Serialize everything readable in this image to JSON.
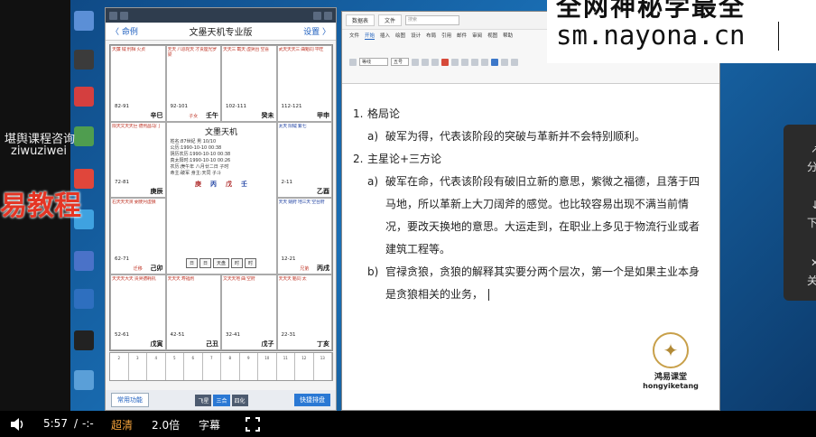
{
  "overlay": {
    "consult_line1": "堪舆课程咨询",
    "consult_line2": "ziwuziwei",
    "brand": "易教程"
  },
  "watermark": {
    "line1": "全网神秘学最全",
    "line2": "sm.nayona.cn"
  },
  "phone": {
    "nav_back": "〈 命例",
    "nav_title": "文墨天机专业版",
    "nav_save": "设置 〉",
    "center_title": "文墨天机",
    "center_lines": [
      "姓名:87世紀 男 10/10",
      "公历:1990-10-10 00:38",
      "阴历农历:1990-10-10 00:38",
      "真太阳时:1990-10-10 00:26",
      "农历:庚午年 八月廿二日 子时",
      "命主:破军 身主:天同 子斗"
    ],
    "pillars": [
      "庚",
      "丙",
      "戊",
      "壬"
    ],
    "center_buttons": [
      "日",
      "日",
      "天盘",
      "时",
      "时"
    ],
    "bottom_left": "常用功能",
    "bottom_mid": [
      "飞星",
      "三合",
      "四化"
    ],
    "bottom_right": "快捷排盘",
    "palaces": [
      {
        "stars": "天廉 钺 刑相 火贞",
        "minor": "",
        "age": "82-91",
        "gz": "辛巳",
        "name": "",
        "blue": false
      },
      {
        "stars": "天天 八恩陀天 才贵座光罗梁",
        "minor": "",
        "age": "92-101",
        "gz": "壬午",
        "name": "子女",
        "blue": false
      },
      {
        "stars": "天天三 截天 虚哭台 空喜",
        "minor": "",
        "age": "102-111",
        "gz": "癸未",
        "name": "",
        "blue": false
      },
      {
        "stars": "武天天天三 曲魁同 平旺",
        "minor": "",
        "age": "112-121",
        "gz": "甲申",
        "name": "",
        "blue": false
      },
      {
        "stars": "陨天文天天巨 德刑昌马门",
        "minor": "",
        "age": "72-81",
        "gz": "庚辰",
        "name": "",
        "blue": false
      },
      {
        "stars": "",
        "minor": "",
        "age": "",
        "gz": "",
        "name": "",
        "blue": false
      },
      {
        "stars": "",
        "minor": "",
        "age": "",
        "gz": "",
        "name": "",
        "blue": false
      },
      {
        "stars": "太天 阳钺 紫七",
        "minor": "",
        "age": "2-11",
        "gz": "乙酉",
        "name": "",
        "blue": true
      },
      {
        "stars": "右天天天贪 弼使月虚狼",
        "minor": "",
        "age": "62-71",
        "gz": "己卯",
        "name": "迁移",
        "blue": false
      },
      {
        "stars": "",
        "minor": "",
        "age": "",
        "gz": "",
        "name": "",
        "blue": false
      },
      {
        "stars": "",
        "minor": "",
        "age": "",
        "gz": "",
        "name": "",
        "blue": false
      },
      {
        "stars": "天天 姚府 地三天 空台府",
        "minor": "",
        "age": "12-21",
        "gz": "丙戌",
        "name": "兄弟",
        "blue": true
      },
      {
        "stars": "天天天大天 贵哭德耗机",
        "minor": "",
        "age": "52-61",
        "gz": "戊寅",
        "name": "",
        "blue": false
      },
      {
        "stars": "天天天 寿福刑",
        "minor": "",
        "age": "42-51",
        "gz": "己丑",
        "name": "",
        "blue": false
      },
      {
        "stars": "文天天地 曲 空府",
        "minor": "",
        "age": "32-41",
        "gz": "戊子",
        "name": "",
        "blue": false
      },
      {
        "stars": "天天天 魁同 太",
        "minor": "",
        "age": "22-31",
        "gz": "丁亥",
        "name": "",
        "blue": false
      }
    ],
    "age_row": [
      "2",
      "3",
      "4",
      "5",
      "6",
      "7",
      "8",
      "9",
      "10",
      "11",
      "12",
      "13"
    ]
  },
  "word": {
    "tab1": "数据表",
    "tab2": "文件",
    "search_placeholder": "搜索",
    "menu": [
      "文件",
      "开始",
      "插入",
      "绘图",
      "设计",
      "布局",
      "引用",
      "邮件",
      "审阅",
      "视图",
      "帮助"
    ],
    "active_menu": "开始",
    "font_box": "等线",
    "size_box": "五号",
    "doc": [
      {
        "num": "1.",
        "text": "格局论"
      },
      {
        "num": "a)",
        "text": "破军为得，代表该阶段的突破与革新并不会特别顺利。",
        "lvl": 2
      },
      {
        "num": "2.",
        "text": "主星论+三方论"
      },
      {
        "num": "a)",
        "text": "破军在命，代表该阶段有破旧立新的意思，紫微之福德，且落于四马地，所以革新上大刀阔斧的感觉。也比较容易出现不满当前情况，要改天换地的意思。大运走到，在职业上多见于物流行业或者建筑工程等。",
        "lvl": 2
      },
      {
        "num": "b)",
        "text": "官禄贪狼，贪狼的解释其实要分两个层次，第一个是如果主业本身是贪狼相关的业务，",
        "lvl": 2
      }
    ]
  },
  "logo": {
    "cn": "鸿易课堂",
    "en": "hongyiketang"
  },
  "side_panel": {
    "items": [
      "分",
      "下",
      "关"
    ]
  },
  "player": {
    "time": "5:57",
    "separator": "/",
    "total": "-:-",
    "quality": "超清",
    "speed": "2.0倍",
    "subtitle": "字幕"
  },
  "colors": {
    "accent_red": "#e53524",
    "link_blue": "#1e5fbf",
    "gold": "#c8a04a",
    "desktop": "#1a6fb5"
  }
}
